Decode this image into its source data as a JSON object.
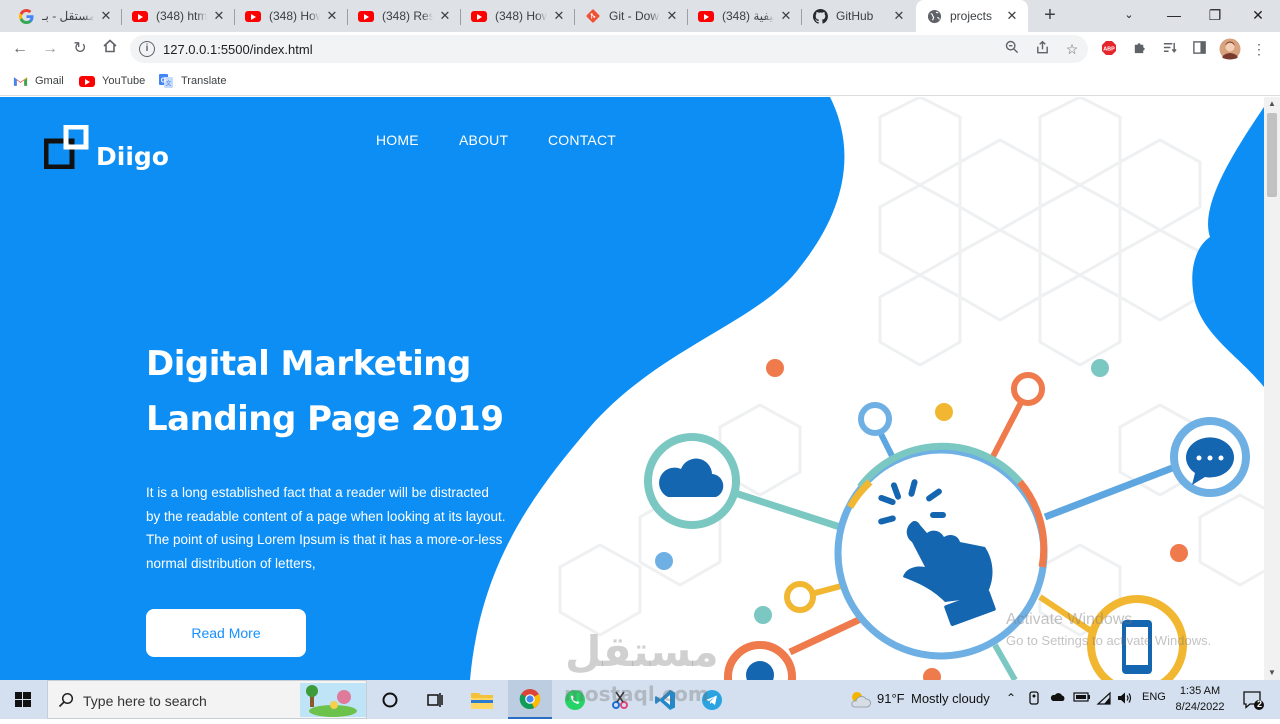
{
  "browser": {
    "tabs": [
      {
        "title": "مستقل - بـ",
        "icon": "google-icon",
        "active": false
      },
      {
        "title": "(348) html",
        "icon": "youtube-icon",
        "active": false
      },
      {
        "title": "(348) How",
        "icon": "youtube-icon",
        "active": false
      },
      {
        "title": "(348) Resp",
        "icon": "youtube-icon",
        "active": false
      },
      {
        "title": "(348) How",
        "icon": "youtube-icon",
        "active": false
      },
      {
        "title": "Git - Down",
        "icon": "git-icon",
        "active": false
      },
      {
        "title": "(348) كيفية",
        "icon": "youtube-icon",
        "active": false
      },
      {
        "title": "GitHub",
        "icon": "github-icon",
        "active": false
      },
      {
        "title": "projects",
        "icon": "globe-icon",
        "active": true
      }
    ],
    "url": "127.0.0.1:5500/index.html",
    "bookmarks": [
      {
        "label": "Gmail",
        "icon": "gmail-icon"
      },
      {
        "label": "YouTube",
        "icon": "youtube-icon"
      },
      {
        "label": "Translate",
        "icon": "translate-icon"
      }
    ]
  },
  "page": {
    "logo_text": "Diigo",
    "nav": [
      "HOME",
      "ABOUT",
      "CONTACT"
    ],
    "hero_title_line1": "Digital Marketing",
    "hero_title_line2": "Landing Page 2019",
    "hero_text": "It is a long established fact that a reader will be distracted by the readable content of a page when looking at its layout. The point of using Lorem Ipsum is that it has a more-or-less normal distribution of letters,",
    "cta_label": "Read More",
    "colors": {
      "primary_blue": "#0c8ef4",
      "button_text": "#1590ff"
    }
  },
  "watermarks": {
    "activate_title": "Activate Windows",
    "activate_sub": "Go to Settings to activate Windows.",
    "mostaql_brand": "مستقل",
    "mostaql_domain": "mostaql.com"
  },
  "taskbar": {
    "search_placeholder": "Type here to search",
    "weather_temp": "91°F",
    "weather_desc": "Mostly cloudy",
    "language": "ENG",
    "time": "1:35 AM",
    "date": "8/24/2022",
    "notifications_count": "2"
  }
}
